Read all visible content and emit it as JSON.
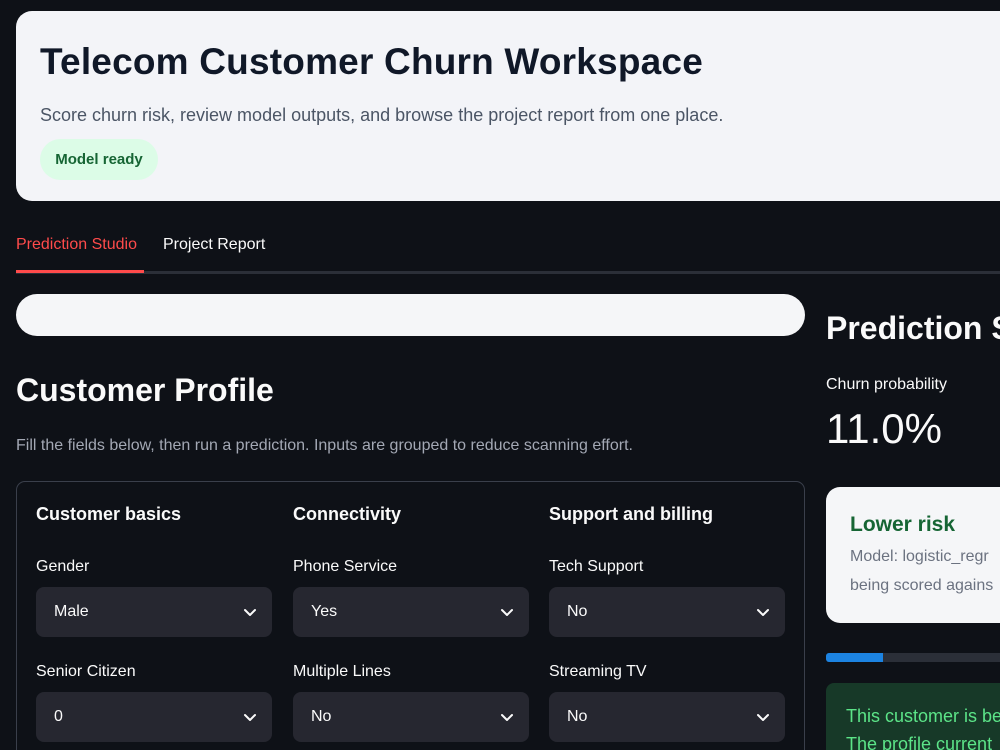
{
  "header": {
    "title": "Telecom Customer Churn Workspace",
    "subtitle": "Score churn risk, review model outputs, and browse the project report from one place.",
    "badge": "Model ready"
  },
  "tabs": [
    {
      "label": "Prediction Studio",
      "active": true
    },
    {
      "label": "Project Report",
      "active": false
    }
  ],
  "profile": {
    "title": "Customer Profile",
    "caption": "Fill the fields below, then run a prediction. Inputs are grouped to reduce scanning effort.",
    "groups": [
      {
        "title": "Customer basics",
        "fields": [
          {
            "label": "Gender",
            "value": "Male"
          },
          {
            "label": "Senior Citizen",
            "value": "0"
          }
        ]
      },
      {
        "title": "Connectivity",
        "fields": [
          {
            "label": "Phone Service",
            "value": "Yes"
          },
          {
            "label": "Multiple Lines",
            "value": "No"
          }
        ]
      },
      {
        "title": "Support and billing",
        "fields": [
          {
            "label": "Tech Support",
            "value": "No"
          },
          {
            "label": "Streaming TV",
            "value": "No"
          }
        ]
      }
    ]
  },
  "prediction": {
    "title": "Prediction S",
    "metric_label": "Churn probability",
    "metric_value": "11.0%",
    "probability": 0.11,
    "risk": {
      "title": "Lower risk",
      "line1": "Model: logistic_regr",
      "line2": "being scored agains"
    },
    "message": {
      "line1": "This customer is be",
      "line2": "The profile current"
    }
  },
  "colors": {
    "accent": "#ff4b4b",
    "success": "#166534",
    "progress": "#1c83e1",
    "background": "#0e1117"
  }
}
